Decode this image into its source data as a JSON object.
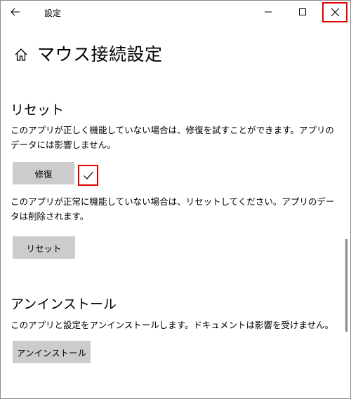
{
  "window": {
    "title": "設定",
    "icons": {
      "back": "back-arrow-icon",
      "minimize": "minimize-icon",
      "maximize": "maximize-icon",
      "close": "close-icon",
      "home": "home-icon"
    }
  },
  "page": {
    "title": "マウス接続設定"
  },
  "reset_section": {
    "title": "リセット",
    "repair_description": "このアプリが正しく機能していない場合は、修復を試すことができます。アプリのデータには影響しません。",
    "repair_button": "修復",
    "repair_status_icon": "checkmark-icon",
    "reset_description": "このアプリが正常に機能していない場合は、リセットしてください。アプリのデータは削除されます。",
    "reset_button": "リセット"
  },
  "uninstall_section": {
    "title": "アンインストール",
    "description": "このアプリと設定をアンインストールします。ドキュメントは影響を受けません。",
    "uninstall_button": "アンインストール"
  },
  "highlight_color": "#e00000"
}
